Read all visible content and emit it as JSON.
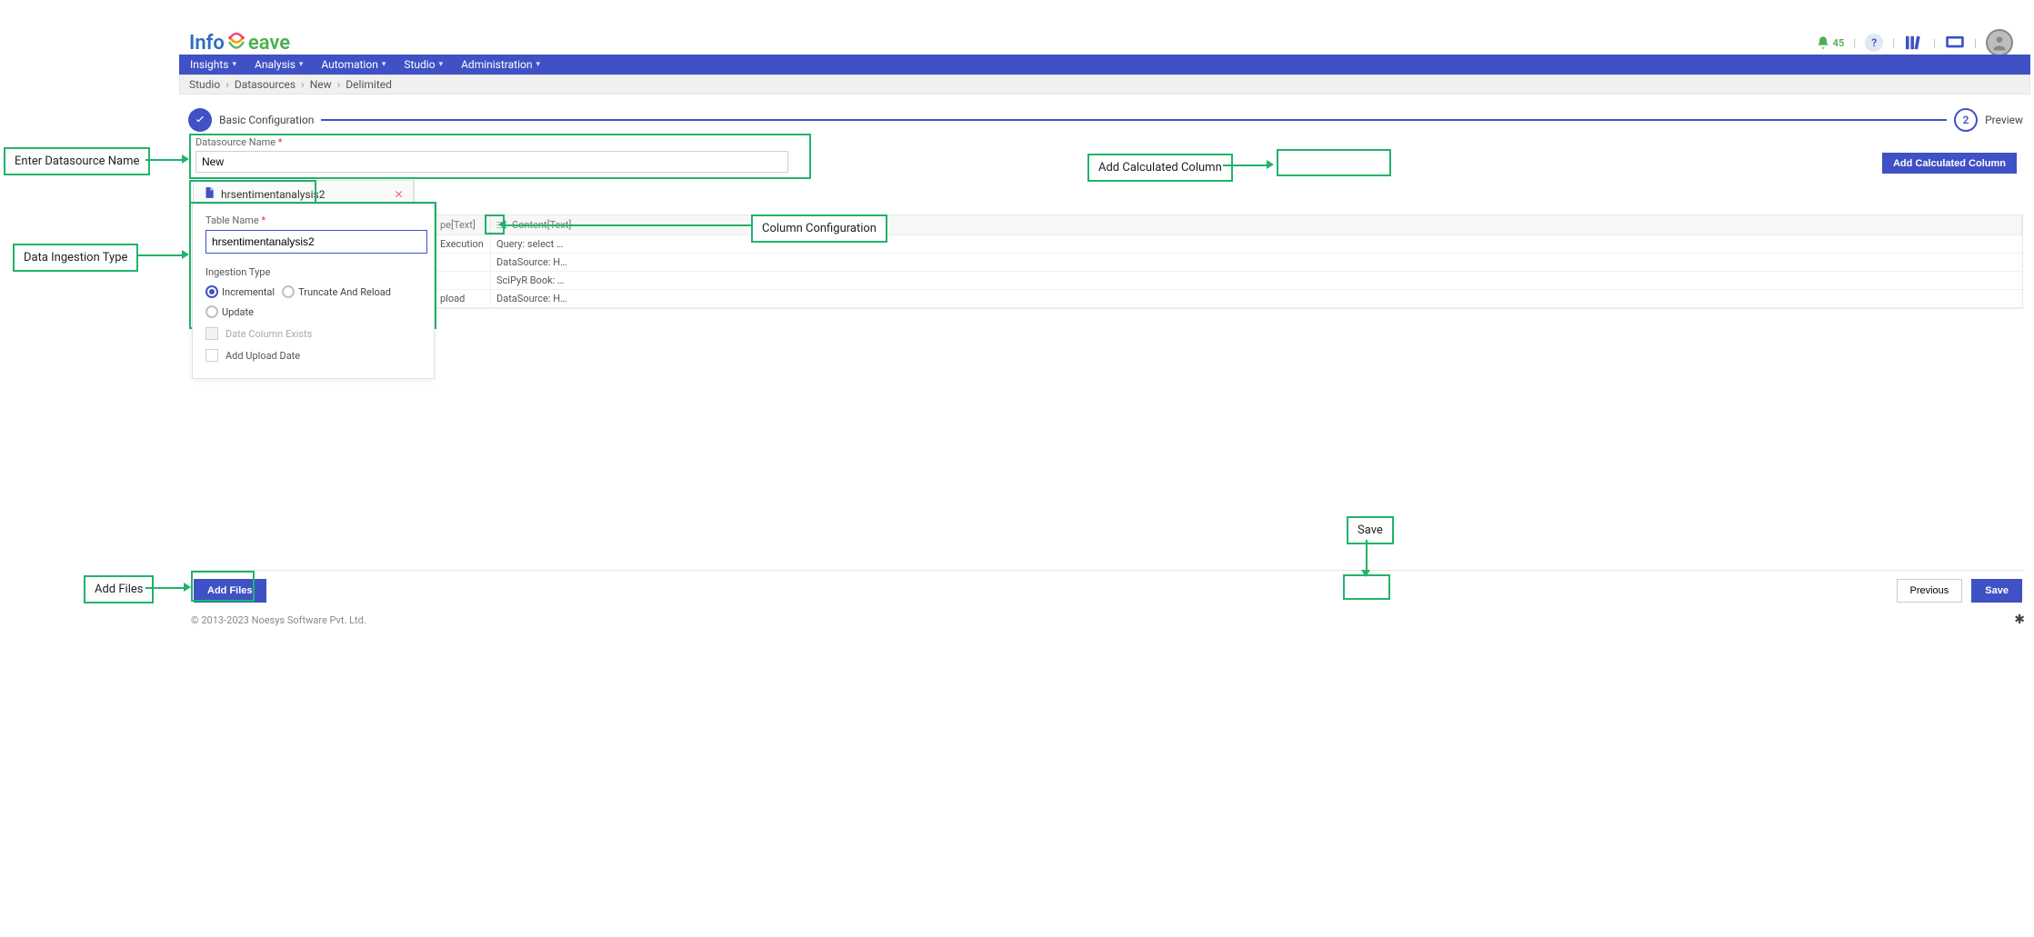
{
  "logo": {
    "part1": "Info",
    "part2": "eave"
  },
  "header": {
    "notification_count": "45",
    "help_char": "?"
  },
  "nav": {
    "items": [
      "Insights",
      "Analysis",
      "Automation",
      "Studio",
      "Administration"
    ]
  },
  "breadcrumb": {
    "items": [
      "Studio",
      "Datasources",
      "New",
      "Delimited"
    ]
  },
  "wizard": {
    "step1_label": "Basic Configuration",
    "step2_num": "2",
    "step2_label": "Preview"
  },
  "form": {
    "ds_label": "Datasource Name",
    "ds_value": "New",
    "table_label": "Table Name",
    "table_value": "hrsentimentanalysis2",
    "ingestion_label": "Ingestion Type",
    "radios": {
      "incremental": "Incremental",
      "truncate": "Truncate And Reload",
      "update": "Update"
    },
    "chk_date_exists": "Date Column Exists",
    "chk_add_upload": "Add Upload Date"
  },
  "tab": {
    "name": "hrsentimentanalysis2"
  },
  "buttons": {
    "add_calc": "Add Calculated Column",
    "add_files": "Add Files",
    "previous": "Previous",
    "save": "Save"
  },
  "table": {
    "col_type": "pe[Text]",
    "col_content": "Content[Text]",
    "rows": [
      {
        "type": "Execution",
        "content": "Query: select * f..."
      },
      {
        "type": "",
        "content": "DataSource: HR ..."
      },
      {
        "type": "",
        "content": "SciPyR Book: Da..."
      },
      {
        "type": "pload",
        "content": "DataSource: HR ..."
      }
    ]
  },
  "footer": {
    "copy": "© 2013-2023 Noesys Software Pvt. Ltd."
  },
  "callouts": {
    "ds_name": "Enter Datasource Name",
    "ingestion": "Data Ingestion Type",
    "col_config": "Column Configuration",
    "add_calc": "Add Calculated Column",
    "save": "Save",
    "add_files": "Add Files"
  }
}
